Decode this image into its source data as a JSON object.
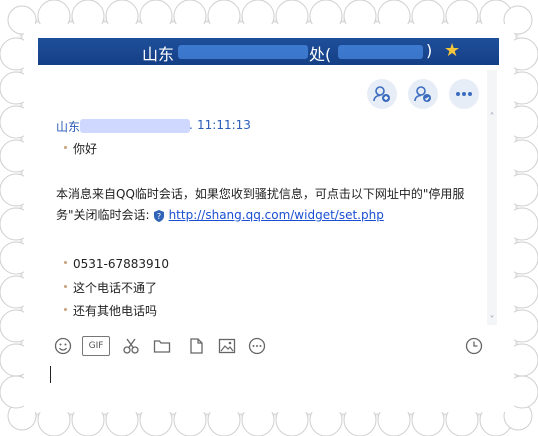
{
  "window": {
    "title_left": "山东",
    "title_mid": "处(",
    "title_right": ")"
  },
  "actions": [
    {
      "name": "add-friend-button",
      "icon": "add-user-icon"
    },
    {
      "name": "add-contact-button",
      "icon": "add-contact-icon"
    },
    {
      "name": "more-button",
      "icon": "more-dots-icon"
    }
  ],
  "chat": {
    "sender_prefix": "山东",
    "sender_suffix": ".",
    "time": "11:11:13",
    "messages": [
      "你好"
    ],
    "system_notice": "本消息来自QQ临时会话，如果您收到骚扰信息，可点击以下网址中的\"停用服务\"关闭临时会话:",
    "system_link": "http://shang.qq.com/widget/set.php",
    "messages_after": [
      "0531-67883910",
      "这个电话不通了",
      "还有其他电话吗"
    ]
  },
  "toolbar": {
    "icons": [
      "emoji-icon",
      "gif-icon",
      "scissors-icon",
      "folder-icon",
      "file-icon",
      "image-icon",
      "more-circle-icon",
      "history-clock-icon"
    ],
    "gif_label": "GIF"
  }
}
